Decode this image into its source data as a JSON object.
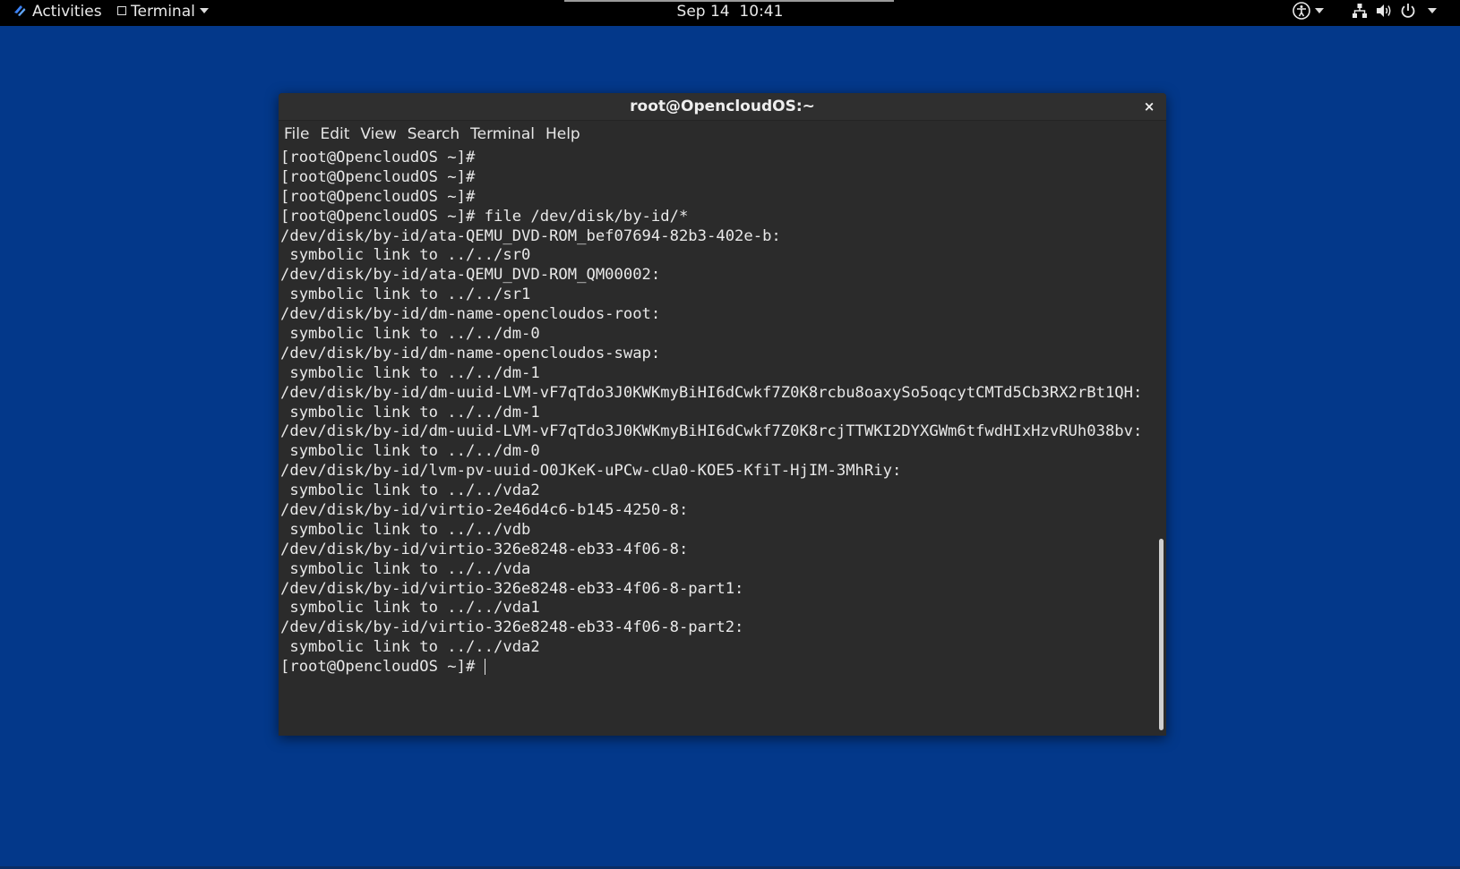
{
  "topbar": {
    "activities_label": "Activities",
    "app_menu_label": "Terminal",
    "clock": "Sep 14  10:41",
    "icons": [
      "accessibility-icon",
      "network-icon",
      "volume-icon",
      "power-icon"
    ]
  },
  "window": {
    "title": "root@OpencloudOS:~",
    "close_label": "×",
    "menu": [
      "File",
      "Edit",
      "View",
      "Search",
      "Terminal",
      "Help"
    ]
  },
  "terminal": {
    "lines": [
      "[root@OpencloudOS ~]#",
      "[root@OpencloudOS ~]#",
      "[root@OpencloudOS ~]#",
      "[root@OpencloudOS ~]# file /dev/disk/by-id/*",
      "/dev/disk/by-id/ata-QEMU_DVD-ROM_bef07694-82b3-402e-b:",
      " symbolic link to ../../sr0",
      "/dev/disk/by-id/ata-QEMU_DVD-ROM_QM00002:",
      " symbolic link to ../../sr1",
      "/dev/disk/by-id/dm-name-opencloudos-root:",
      " symbolic link to ../../dm-0",
      "/dev/disk/by-id/dm-name-opencloudos-swap:",
      " symbolic link to ../../dm-1",
      "/dev/disk/by-id/dm-uuid-LVM-vF7qTdo3J0KWKmyBiHI6dCwkf7Z0K8rcbu8oaxySo5oqcytCMTd5Cb3RX2rBt1QH:",
      " symbolic link to ../../dm-1",
      "/dev/disk/by-id/dm-uuid-LVM-vF7qTdo3J0KWKmyBiHI6dCwkf7Z0K8rcjTTWKI2DYXGWm6tfwdHIxHzvRUh038bv:",
      " symbolic link to ../../dm-0",
      "/dev/disk/by-id/lvm-pv-uuid-O0JKeK-uPCw-cUa0-KOE5-KfiT-HjIM-3MhRiy:",
      " symbolic link to ../../vda2",
      "/dev/disk/by-id/virtio-2e46d4c6-b145-4250-8:",
      " symbolic link to ../../vdb",
      "/dev/disk/by-id/virtio-326e8248-eb33-4f06-8:",
      " symbolic link to ../../vda",
      "/dev/disk/by-id/virtio-326e8248-eb33-4f06-8-part1:",
      " symbolic link to ../../vda1",
      "/dev/disk/by-id/virtio-326e8248-eb33-4f06-8-part2:",
      " symbolic link to ../../vda2",
      "[root@OpencloudOS ~]# "
    ]
  },
  "colors": {
    "desktop": "#03388a",
    "topbar": "#000000",
    "terminal_bg": "#2b2b2b",
    "terminal_fg": "#e8e8e8"
  }
}
